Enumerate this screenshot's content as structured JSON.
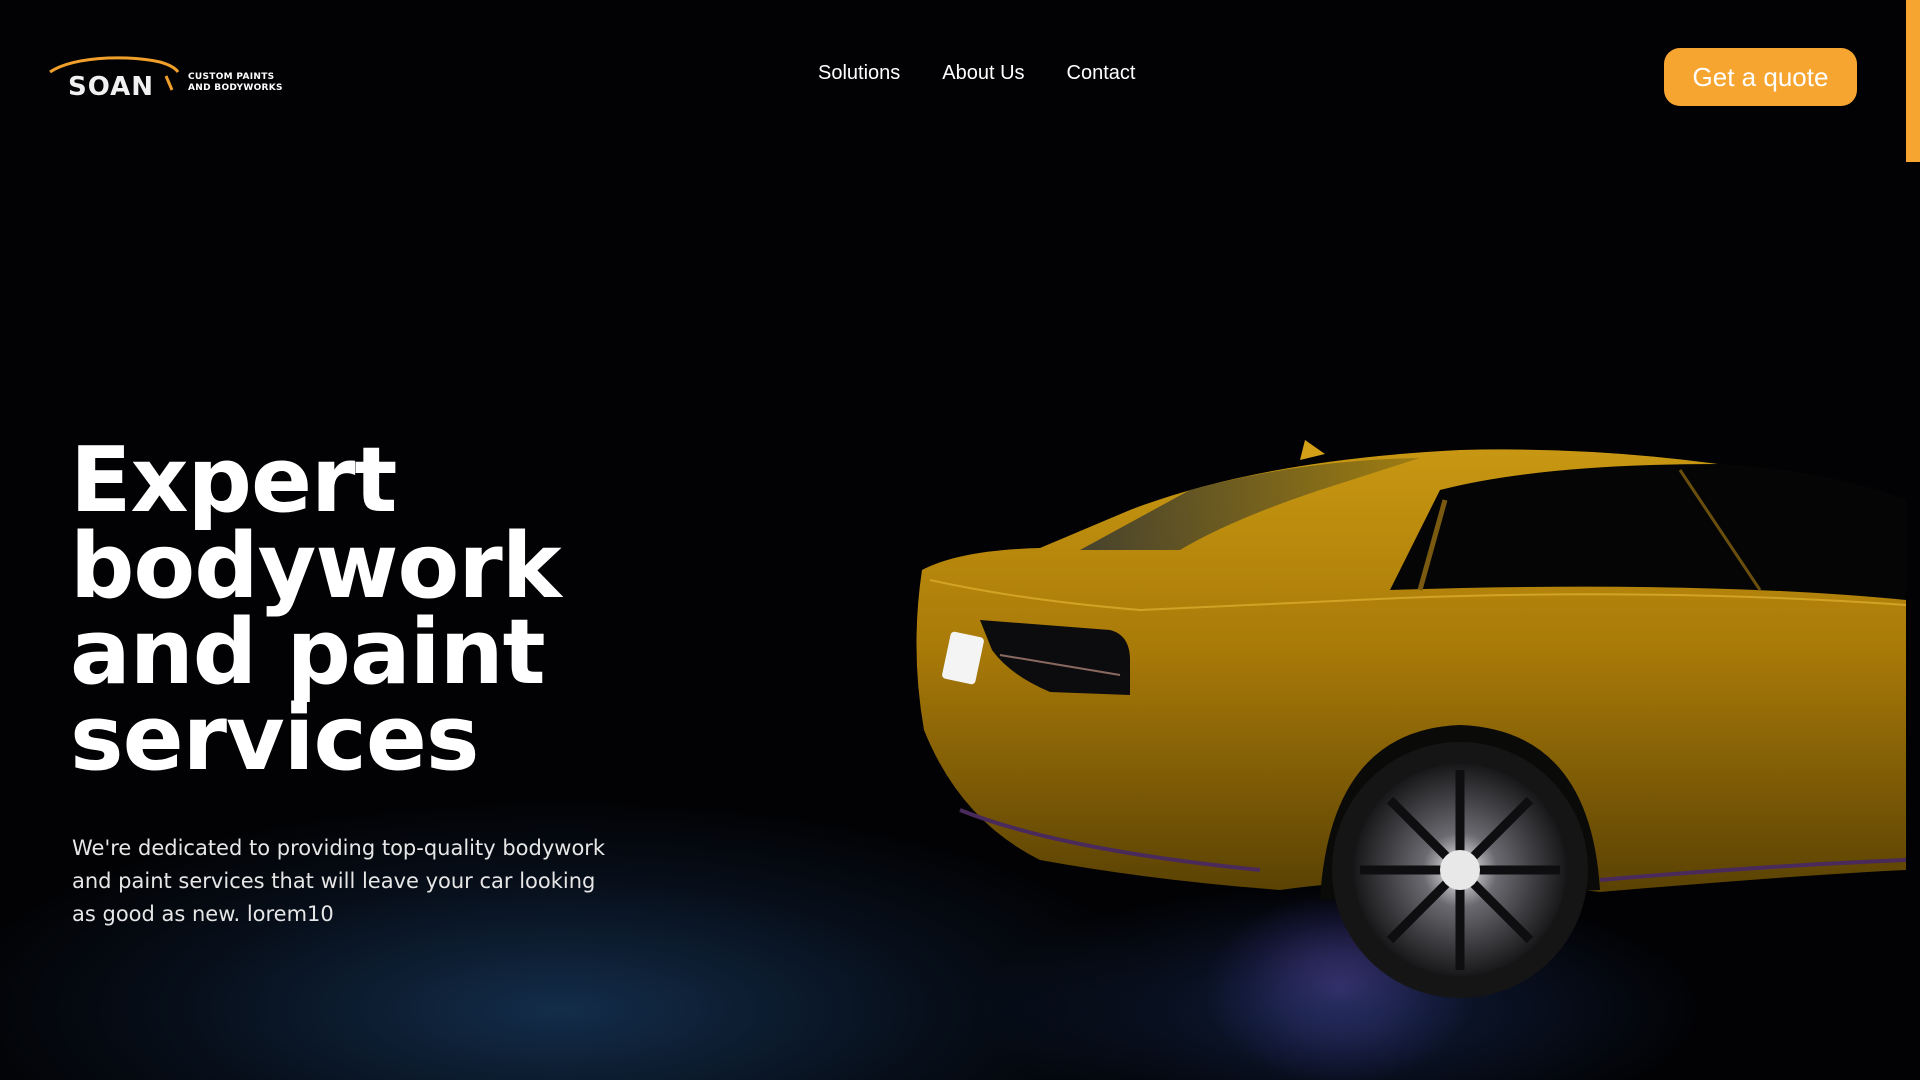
{
  "brand": {
    "logo_word": "SOAN",
    "tagline_line1": "CUSTOM PAINTS",
    "tagline_line2": "AND BODYWORKS",
    "accent_color": "#f7a531"
  },
  "nav": {
    "items": [
      {
        "label": "Solutions"
      },
      {
        "label": "About Us"
      },
      {
        "label": "Contact"
      }
    ]
  },
  "cta": {
    "label": "Get a quote"
  },
  "hero": {
    "title": "Expert bodywork and paint services",
    "subtitle": "We're dedicated to providing top-quality bodywork and paint services that will leave your car looking as good as new. lorem10"
  },
  "scene": {
    "car_color": "#b8860b",
    "ground_glow": "#7a55c0"
  }
}
